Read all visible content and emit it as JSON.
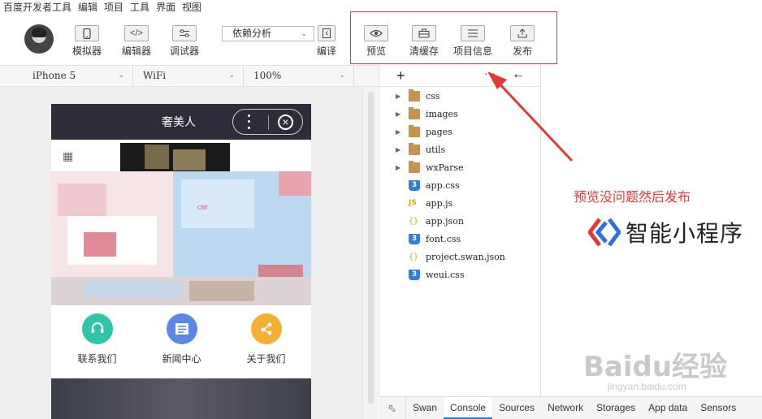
{
  "menu": [
    "百度开发者工具",
    "编辑",
    "项目",
    "工具",
    "界面",
    "视图"
  ],
  "toolbar": {
    "simulator_label": "模拟器",
    "editor_label": "编辑器",
    "debugger_label": "调试器",
    "dependency_select": "依赖分析",
    "compile_label": "编译",
    "preview_label": "预览",
    "clear_cache_label": "清缓存",
    "project_info_label": "项目信息",
    "publish_label": "发布"
  },
  "device_bar": {
    "device": "iPhone 5",
    "network": "WiFi",
    "zoom": "100%"
  },
  "phone": {
    "title": "奢美人",
    "quick_links": [
      "联系我们",
      "新闻中心",
      "关于我们"
    ],
    "banner_text": "CRY"
  },
  "file_tree": [
    {
      "name": "css",
      "type": "folder"
    },
    {
      "name": "images",
      "type": "folder"
    },
    {
      "name": "pages",
      "type": "folder"
    },
    {
      "name": "utils",
      "type": "folder"
    },
    {
      "name": "wxParse",
      "type": "folder"
    },
    {
      "name": "app.css",
      "type": "css"
    },
    {
      "name": "app.js",
      "type": "js"
    },
    {
      "name": "app.json",
      "type": "json"
    },
    {
      "name": "font.css",
      "type": "css"
    },
    {
      "name": "project.swan.json",
      "type": "json"
    },
    {
      "name": "weui.css",
      "type": "css"
    }
  ],
  "annotation": "预览没问题然后发布",
  "brand_name": "智能小程序",
  "watermark": {
    "line1": "Baidu经验",
    "line2": "jingyan.baidu.com"
  },
  "devtools_tabs": [
    "Swan",
    "Console",
    "Sources",
    "Network",
    "Storages",
    "App data",
    "Sensors"
  ],
  "devtools_active_tab": "Console",
  "colors": {
    "accent_red": "#e53935",
    "tab_blue": "#2f7ed8",
    "nav_dark": "#2f2c3a"
  }
}
